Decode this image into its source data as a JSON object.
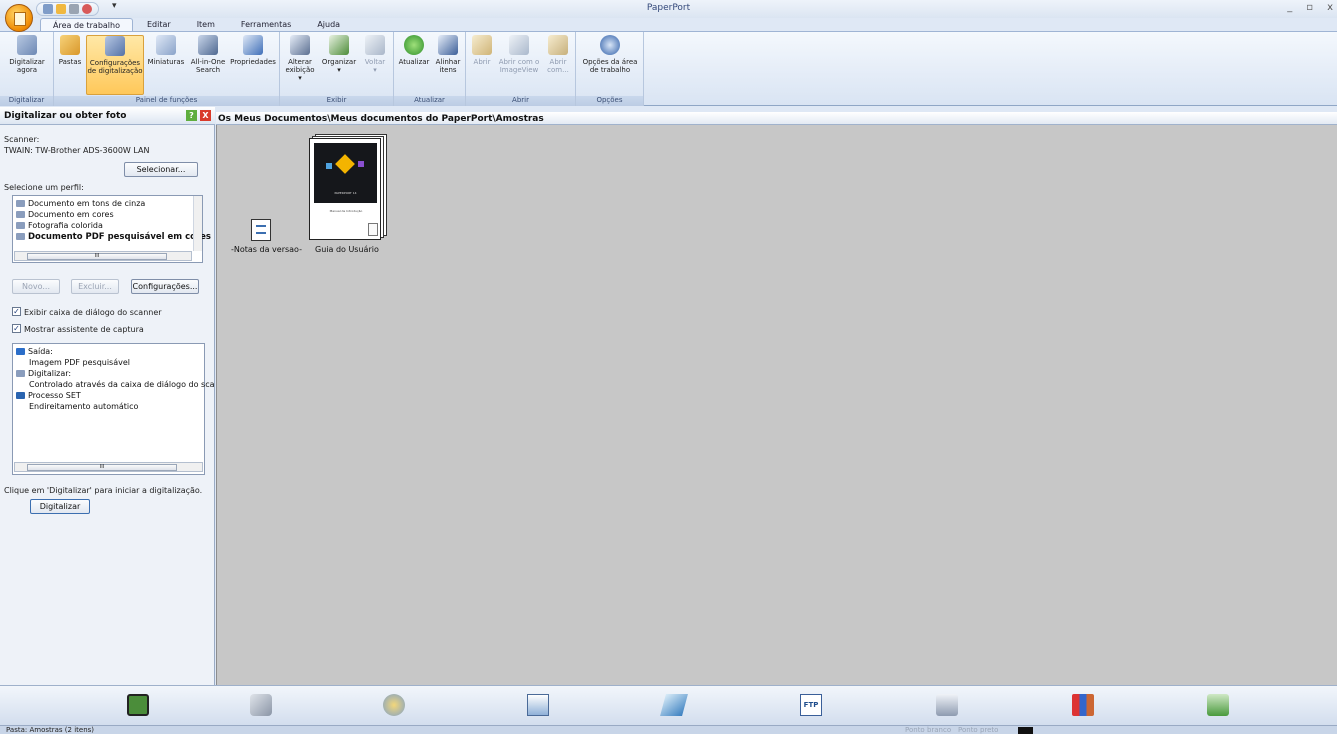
{
  "app": {
    "title": "PaperPort",
    "minimize": "_",
    "restore": "▫",
    "close": "x"
  },
  "tabs": [
    {
      "label": "Área de trabalho",
      "active": true
    },
    {
      "label": "Editar"
    },
    {
      "label": "Item"
    },
    {
      "label": "Ferramentas"
    },
    {
      "label": "Ajuda"
    }
  ],
  "ribbon": {
    "groups": {
      "digitalizar": "Digitalizar",
      "painel": "Painel de funções",
      "exibir": "Exibir",
      "atualizar": "Atualizar",
      "abrir": "Abrir",
      "opcoes": "Opções"
    },
    "buttons": {
      "digitalizar_agora_1": "Digitalizar",
      "digitalizar_agora_2": "agora",
      "pastas": "Pastas",
      "config_1": "Configurações",
      "config_2": "de digitalização",
      "miniaturas": "Miniaturas",
      "allinone_1": "All-in-One",
      "allinone_2": "Search",
      "propriedades": "Propriedades",
      "alterar_1": "Alterar",
      "alterar_2": "exibição ▾",
      "organizar_1": "Organizar",
      "organizar_2": "▾",
      "voltar_1": "Voltar",
      "voltar_2": "▾",
      "atualizar": "Atualizar",
      "alinhar_1": "Alinhar",
      "alinhar_2": "itens",
      "abrir": "Abrir",
      "abrir_com_o_1": "Abrir com o",
      "abrir_com_o_2": "ImageView",
      "abrir_com_1": "Abrir",
      "abrir_com_2": "com...",
      "opcoes_1": "Opções da área",
      "opcoes_2": "de trabalho"
    }
  },
  "left": {
    "title": "Digitalizar ou obter foto",
    "help": "?",
    "close": "X",
    "scanner_label": "Scanner:",
    "scanner_value": "TWAIN: TW-Brother ADS-3600W LAN",
    "select_button": "Selecionar...",
    "profile_label": "Selecione um perfil:",
    "profiles": [
      "Documento em tons de cinza",
      "Documento em cores",
      "Fotografia colorida",
      "Documento PDF pesquisável em cores"
    ],
    "scroll_mark": "III",
    "novo": "Novo...",
    "excluir": "Excluir...",
    "configuracoes": "Configurações...",
    "check1": "Exibir caixa de diálogo do scanner",
    "check2": "Mostrar assistente de captura",
    "check_mark": "✓",
    "details": [
      "Saída:",
      "Imagem PDF pesquisável",
      "Digitalizar:",
      "Controlado através da caixa de diálogo do sca",
      "Processo SET",
      "Endireitamento automático"
    ],
    "hint": "Clique em 'Digitalizar' para iniciar a digitalização.",
    "scan_button": "Digitalizar"
  },
  "main": {
    "path": "Os Meus Documentos\\Meus documentos do PaperPort\\Amostras",
    "items": [
      {
        "label": "-Notas da versao-"
      },
      {
        "label": "Guia do Usuário"
      }
    ],
    "doc_cover_title": "PAPERPORT 14",
    "doc_cover_sub": "Manual de Introdução"
  },
  "colors": {
    "accent": "#ffc85a",
    "ribbon": "#d9e4f3",
    "workspace": "#c7c7c7"
  },
  "bottom_icons": [
    "evernote-icon",
    "scanner-icon",
    "paint-icon",
    "image-viewer-icon",
    "ocr-icon",
    "ftp-icon",
    "printer-icon",
    "people-icon",
    "recycle-icon"
  ],
  "status": {
    "text": "Pasta: Amostras (2 itens)",
    "ponto_branco": "Ponto branco",
    "ponto_preto": "Ponto preto"
  }
}
